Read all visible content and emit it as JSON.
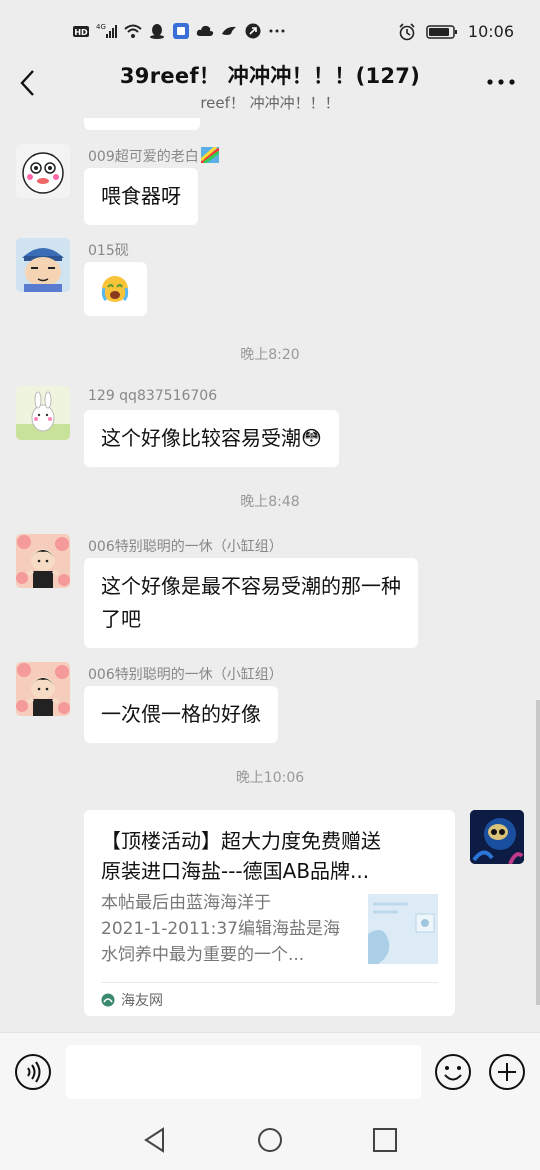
{
  "status_bar": {
    "time": "10:06",
    "network": "4G",
    "icons_left": [
      "hd-icon",
      "signal-icon",
      "wifi-icon",
      "qq-icon",
      "app-icon",
      "cloud-icon",
      "bird-icon",
      "shield-icon",
      "more-dots-icon"
    ],
    "icons_right": [
      "alarm-icon",
      "battery-icon"
    ]
  },
  "header": {
    "title": "39reef！ 冲冲冲！！！(127)",
    "subtitle": "reef！ 冲冲冲！！！"
  },
  "messages": [
    {
      "type": "incoming",
      "sender": "009超可爱的老白",
      "text": "喂食器呀",
      "avatar": "cartoon-face"
    },
    {
      "type": "incoming",
      "sender": "015砚",
      "emoji": "😭",
      "avatar": "cartoon-boy"
    },
    {
      "type": "time",
      "text": "晚上8:20"
    },
    {
      "type": "incoming",
      "sender": "129 qq837516706",
      "text": "这个好像比较容易受潮",
      "emoji": "😳",
      "avatar": "rabbit"
    },
    {
      "type": "time",
      "text": "晚上8:48"
    },
    {
      "type": "incoming",
      "sender": "006特别聪明的一休（小缸组）",
      "lines": [
        "这个好像是最不容易受潮的那一种",
        "了吧"
      ],
      "avatar": "flower-boy"
    },
    {
      "type": "incoming",
      "sender": "006特别聪明的一休（小缸组）",
      "text": "一次偎一格的好像",
      "avatar": "flower-boy"
    },
    {
      "type": "time",
      "text": "晚上10:06"
    }
  ],
  "link_card": {
    "title_lines": [
      "【顶楼活动】超大力度免费赠送",
      "原装进口海盐---德国AB品牌..."
    ],
    "desc_lines": [
      "本帖最后由蓝海海洋于",
      "2021-1-2011:37编辑海盐是海",
      "水饲养中最为重要的一个..."
    ],
    "source": "海友网"
  },
  "input_bar": {
    "placeholder": ""
  },
  "colors": {
    "background": "#ededed",
    "bubble": "#ffffff",
    "accent_green": "#3a8a6e"
  }
}
